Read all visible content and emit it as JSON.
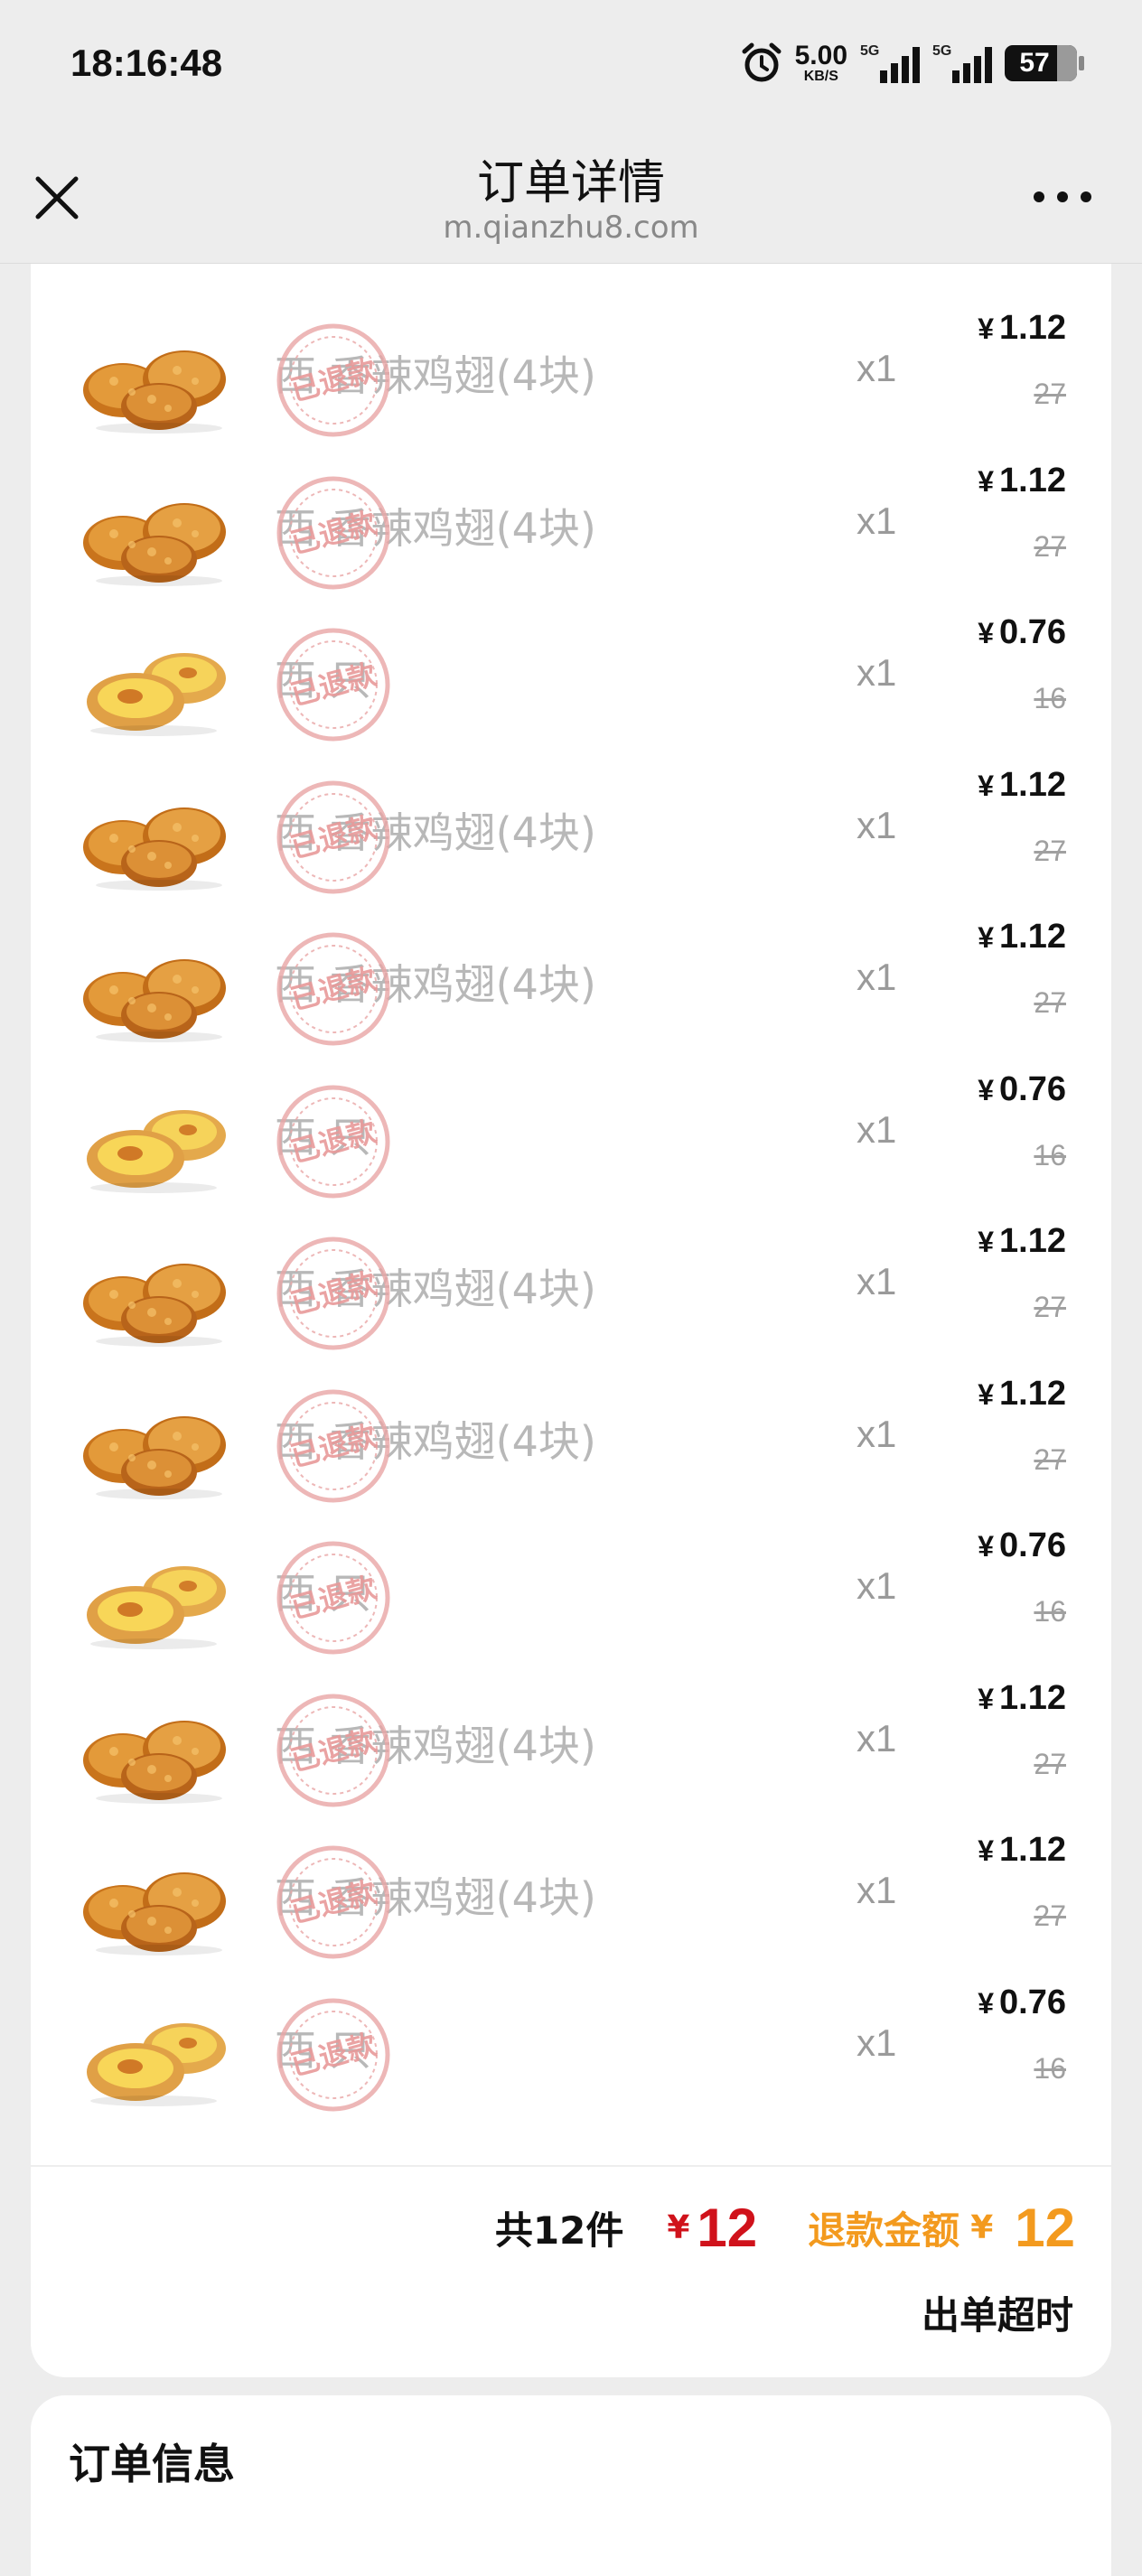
{
  "status_bar": {
    "time": "18:16:48",
    "net_speed": "5.00",
    "net_unit": "KB/S",
    "signal1_label": "5G",
    "signal2_label": "5G",
    "battery": "57"
  },
  "nav": {
    "title": "订单详情",
    "subtitle": "m.qianzhu8.com"
  },
  "stamp_text": "已退款",
  "items": [
    {
      "name": "西  香辣鸡翅(4块)",
      "type": "wings",
      "qty": "x1",
      "currency": "¥",
      "price": "1.12",
      "original": "27"
    },
    {
      "name": "西  香辣鸡翅(4块)",
      "type": "wings",
      "qty": "x1",
      "currency": "¥",
      "price": "1.12",
      "original": "27"
    },
    {
      "name": "西     只",
      "type": "tart",
      "qty": "x1",
      "currency": "¥",
      "price": "0.76",
      "original": "16"
    },
    {
      "name": "西  香辣鸡翅(4块)",
      "type": "wings",
      "qty": "x1",
      "currency": "¥",
      "price": "1.12",
      "original": "27"
    },
    {
      "name": "西  香辣鸡翅(4块)",
      "type": "wings",
      "qty": "x1",
      "currency": "¥",
      "price": "1.12",
      "original": "27"
    },
    {
      "name": "西     只",
      "type": "tart",
      "qty": "x1",
      "currency": "¥",
      "price": "0.76",
      "original": "16"
    },
    {
      "name": "西  香辣鸡翅(4块)",
      "type": "wings",
      "qty": "x1",
      "currency": "¥",
      "price": "1.12",
      "original": "27"
    },
    {
      "name": "西  香辣鸡翅(4块)",
      "type": "wings",
      "qty": "x1",
      "currency": "¥",
      "price": "1.12",
      "original": "27"
    },
    {
      "name": "西     只",
      "type": "tart",
      "qty": "x1",
      "currency": "¥",
      "price": "0.76",
      "original": "16"
    },
    {
      "name": "西  香辣鸡翅(4块)",
      "type": "wings",
      "qty": "x1",
      "currency": "¥",
      "price": "1.12",
      "original": "27"
    },
    {
      "name": "西  香辣鸡翅(4块)",
      "type": "wings",
      "qty": "x1",
      "currency": "¥",
      "price": "1.12",
      "original": "27"
    },
    {
      "name": "西     只",
      "type": "tart",
      "qty": "x1",
      "currency": "¥",
      "price": "0.76",
      "original": "16"
    }
  ],
  "summary": {
    "count_label": "共12件",
    "currency": "¥",
    "total": "12",
    "refund_label": "退款金额",
    "refund_currency": "¥",
    "refund_amount": "12",
    "status": "出单超时"
  },
  "order_info": {
    "title": "订单信息"
  },
  "colors": {
    "accent_red": "#d0121b",
    "refund_orange": "#f39a1e",
    "stamp_red": "#e8a5a5"
  }
}
